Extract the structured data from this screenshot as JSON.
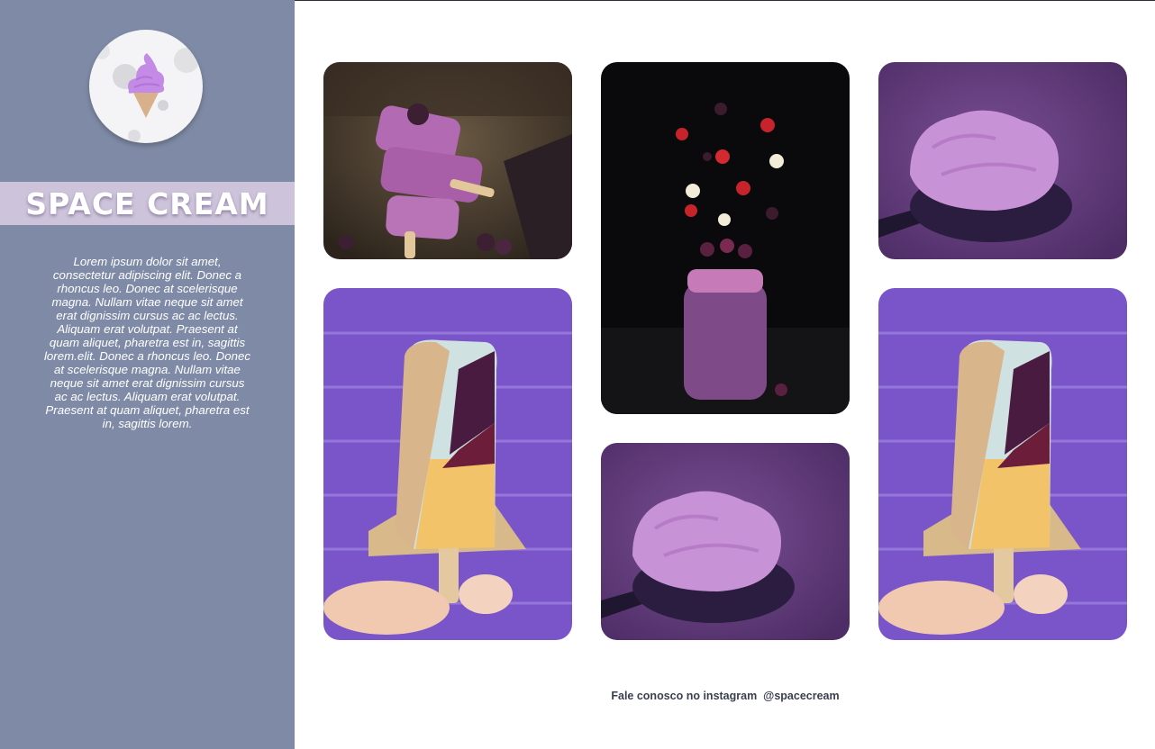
{
  "brand": {
    "name": "SPACE CREAM",
    "logo_icon": "ice-cream-cone-icon"
  },
  "sidebar": {
    "description": "Lorem ipsum dolor sit amet, consectetur adipiscing elit. Donec a rhoncus leo. Donec at scelerisque magna. Nullam vitae neque sit amet erat dignissim cursus ac ac lectus. Aliquam erat volutpat. Praesent at quam aliquet, pharetra est in, sagittis lorem.elit. Donec a rhoncus leo. Donec at scelerisque magna. Nullam vitae neque sit amet erat dignissim cursus ac ac lectus. Aliquam erat volutpat. Praesent at quam aliquet, pharetra est in, sagittis lorem."
  },
  "gallery": [
    {
      "subject": "purple popsicles with blackberries"
    },
    {
      "subject": "purple smoothie jar with falling fruit"
    },
    {
      "subject": "purple ice cream on spoon"
    },
    {
      "subject": "hand holding nut-coated popsicle"
    },
    {
      "subject": "purple ice cream on spoon"
    },
    {
      "subject": "hand holding nut-coated popsicle"
    }
  ],
  "footer": {
    "text": "Fale conosco no instagram",
    "handle": "@spacecream"
  },
  "colors": {
    "sidebar_bg": "#7f8ba6",
    "title_band": "#cdc3da",
    "accent_purple": "#7a55c9"
  }
}
